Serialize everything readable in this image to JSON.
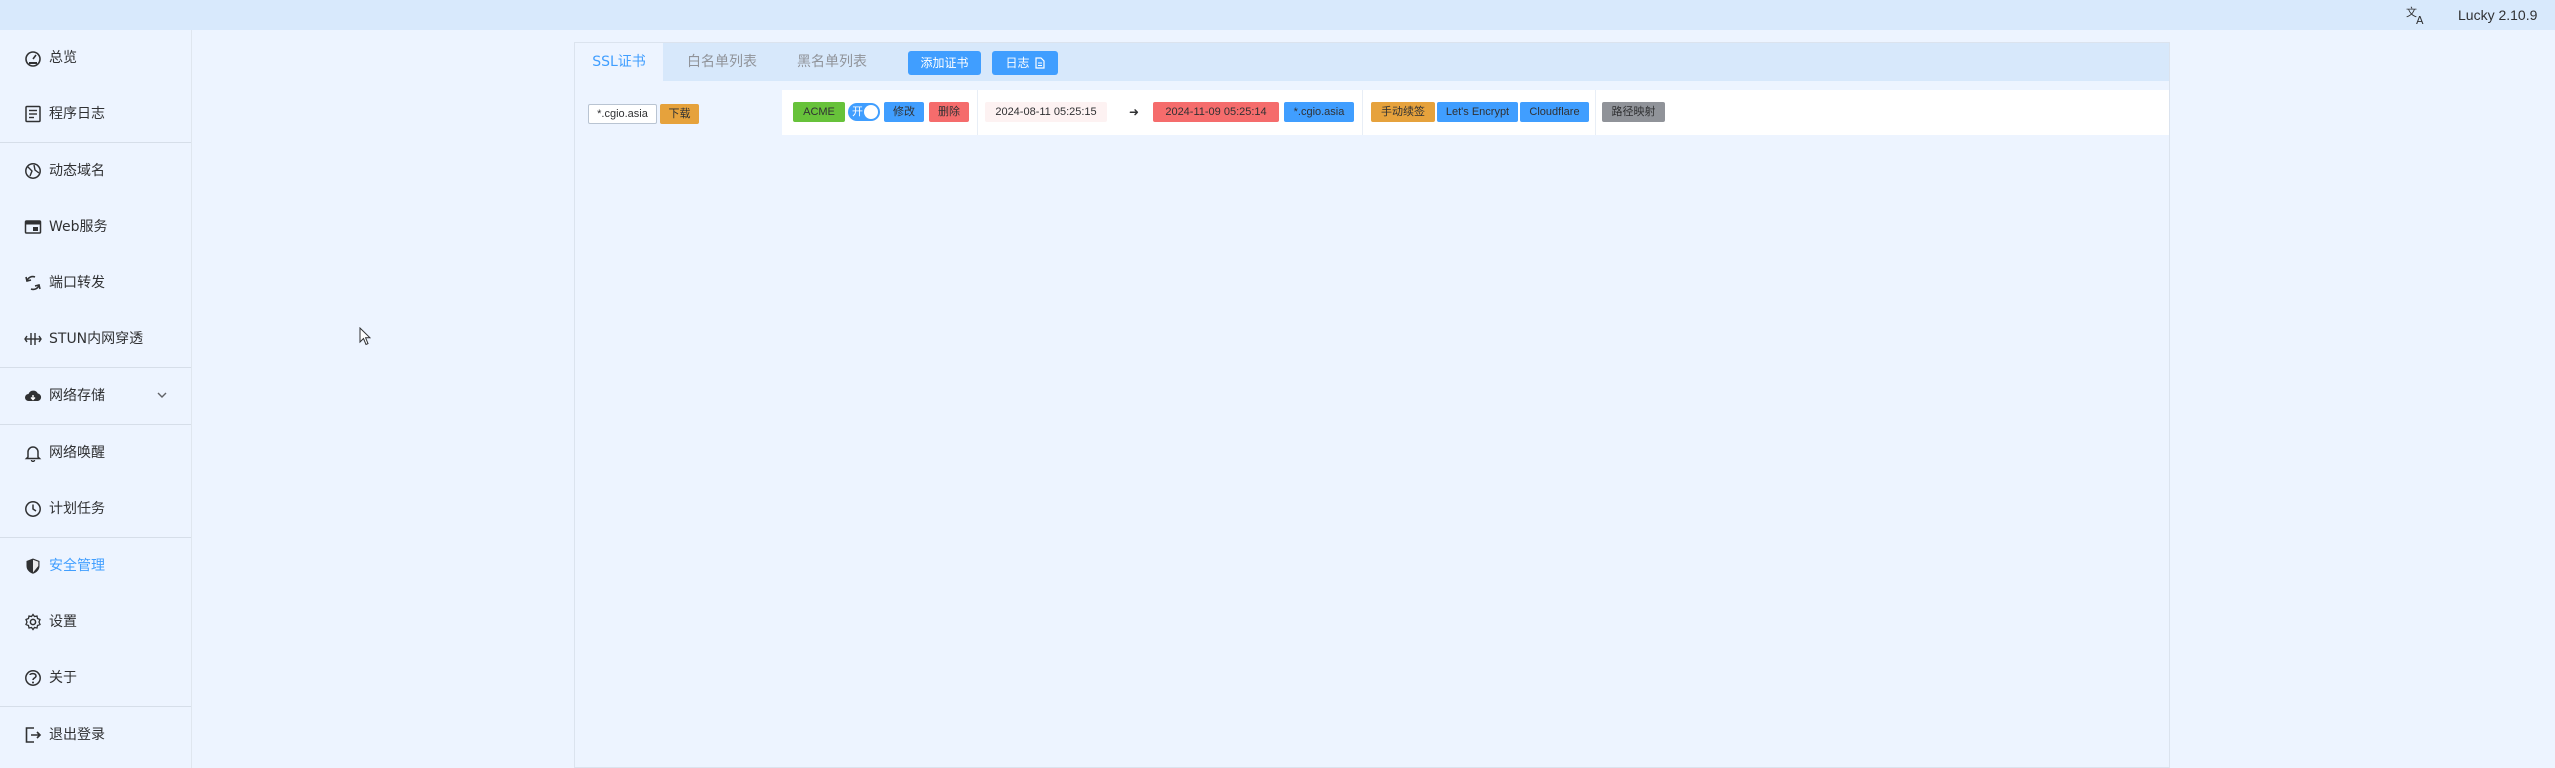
{
  "topbar": {
    "translate_icon": "translate-icon",
    "version": "Lucky 2.10.9"
  },
  "sidebar": {
    "items": [
      {
        "label": "总览",
        "icon": "dashboard-icon"
      },
      {
        "label": "程序日志",
        "icon": "log-icon"
      },
      {
        "label": "动态域名",
        "icon": "globe-icon"
      },
      {
        "label": "Web服务",
        "icon": "web-window-icon"
      },
      {
        "label": "端口转发",
        "icon": "port-forward-icon"
      },
      {
        "label": "STUN内网穿透",
        "icon": "stun-icon"
      },
      {
        "label": "网络存储",
        "icon": "cloud-storage-icon"
      },
      {
        "label": "网络唤醒",
        "icon": "bell-icon"
      },
      {
        "label": "计划任务",
        "icon": "clock-icon"
      },
      {
        "label": "安全管理",
        "icon": "shield-icon",
        "active": true
      },
      {
        "label": "设置",
        "icon": "gear-icon"
      },
      {
        "label": "关于",
        "icon": "about-icon"
      },
      {
        "label": "退出登录",
        "icon": "logout-icon"
      }
    ]
  },
  "tabs": [
    {
      "label": "SSL证书",
      "active": true
    },
    {
      "label": "白名单列表"
    },
    {
      "label": "黑名单列表"
    }
  ],
  "buttons": {
    "add_cert": "添加证书",
    "log": "日志"
  },
  "cert_row": {
    "domain": "*.cgio.asia",
    "download": "下载",
    "type": "ACME",
    "switch_label": "开",
    "switch_on": true,
    "edit": "修改",
    "delete": "删除",
    "issued": "2024-08-11 05:25:15",
    "arrow": "➜",
    "expires": "2024-11-09 05:25:14",
    "domain_tag": "*.cgio.asia",
    "renew": "手动续签",
    "ca": "Let's Encrypt",
    "dns": "Cloudflare",
    "path_map": "路径映射"
  },
  "colors": {
    "accent": "#409eff",
    "success": "#67c23a",
    "warning": "#e6a23c",
    "danger": "#f56c6c",
    "info": "#909399"
  }
}
